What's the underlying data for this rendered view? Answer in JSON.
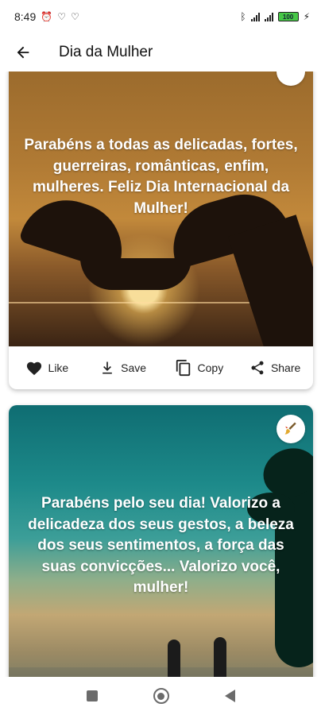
{
  "status_bar": {
    "time": "8:49",
    "icons": [
      "no-alarm-icon",
      "heart-icon",
      "heart-icon"
    ],
    "right_icons": [
      "bluetooth-icon",
      "signal-icon",
      "signal-icon",
      "battery-icon",
      "charging-icon"
    ],
    "battery_label": "100"
  },
  "app_bar": {
    "back_icon": "arrow-left-icon",
    "title": "Dia da Mulher"
  },
  "cards": [
    {
      "image_desc_icon": "heart-hands-sunset",
      "quote": "Parabéns a todas as delicadas, fortes, guerreiras, românticas, enfim, mulheres. Feliz Dia Internacional da Mulher!",
      "actions": {
        "like": "Like",
        "save": "Save",
        "copy": "Copy",
        "share": "Share"
      }
    },
    {
      "image_desc_icon": "beach-palm-couple",
      "quote": "Parabéns pelo seu dia! Valorizo a delicadeza dos seus gestos, a beleza dos seus sentimentos, a força das suas convicções... Valorizo você, mulher!",
      "corner_icon": "brush-icon"
    }
  ],
  "nav_bar": {
    "buttons": [
      "recents-square-icon",
      "home-circle-icon",
      "back-triangle-icon"
    ]
  },
  "colors": {
    "accent": "#222222",
    "card_bg": "#ffffff",
    "quote_text": "#ffffff"
  }
}
